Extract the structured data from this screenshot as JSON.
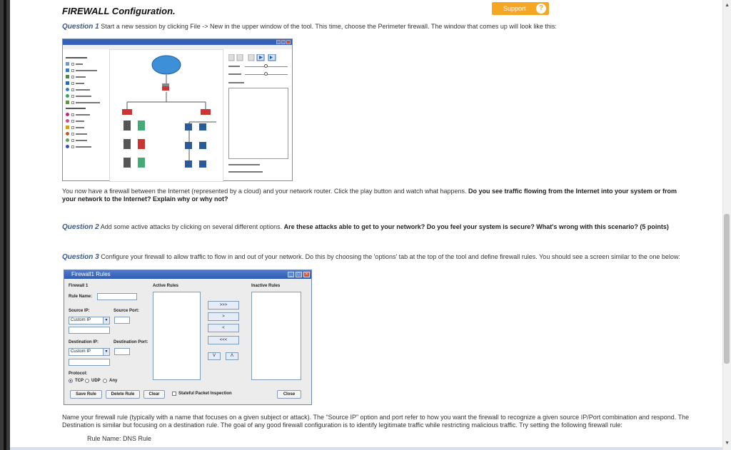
{
  "page": {
    "title": "FIREWALL Configuration.",
    "support_label": "Support",
    "support_icon": "question-icon"
  },
  "q1": {
    "label": "Question 1",
    "text": " Start a new session by clicking File -> New in the upper window of the tool.  This time, choose the Perimeter firewall.  The window that comes up will look like this:"
  },
  "after_q1": {
    "text": "You now have a firewall between the Internet (represented by a cloud) and your network router.  Click the play button and watch what happens.  ",
    "bold": "Do you see traffic flowing from the Internet into your system or from your network to the Internet?  Explain why or why not?"
  },
  "q2": {
    "label": "Question 2",
    "text": " Add some active attacks by clicking on several different options.  ",
    "bold": "Are these attacks able to get to your network?  Do you feel your system is secure?  What's wrong with this scenario? (5 points)"
  },
  "q3": {
    "label": "Question 3",
    "text": " Configure your firewall to allow traffic to flow in and out of your network.  Do this by choosing the 'options' tab at the top of the tool and define firewall rules.  You should see a screen similar to the one below:"
  },
  "rules_window": {
    "title": "Firewall1 Rules",
    "firewall_label": "Firewall 1",
    "active_rules": "Active Rules",
    "inactive_rules": "Inactive Rules",
    "rule_name": "Rule Name:",
    "source_ip": "Source IP:",
    "source_port": "Source Port:",
    "source_select": "Custom IP",
    "dest_ip": "Destination IP:",
    "dest_port": "Destination Port:",
    "dest_select": "Custom IP",
    "protocol": "Protocol:",
    "tcp": "TCP",
    "udp": "UDP",
    "any": "Any",
    "btn_all_right": ">>>",
    "btn_right": ">",
    "btn_left": "<",
    "btn_all_left": "<<<",
    "btn_down": "V",
    "btn_up": "Λ",
    "save_rule": "Save Rule",
    "delete_rule": "Delete Rule",
    "clear": "Clear",
    "stateful": "Stateful Packet Inspection",
    "close": "Close"
  },
  "after_q3": {
    "text": "Name your firewall rule (typically with a name that focuses on a given subject or attack).  The “Source IP” option and port refer to how you want the firewall to recognize a given source IP/Port combination and respond.  The Destination is similar but focusing on a destination rule.  The goal of any good firewall configuration is to identify legitimate traffic while restricting malicious traffic.  Try setting the following firewall rule:",
    "rule_name_line": "Rule Name:  DNS Rule"
  }
}
